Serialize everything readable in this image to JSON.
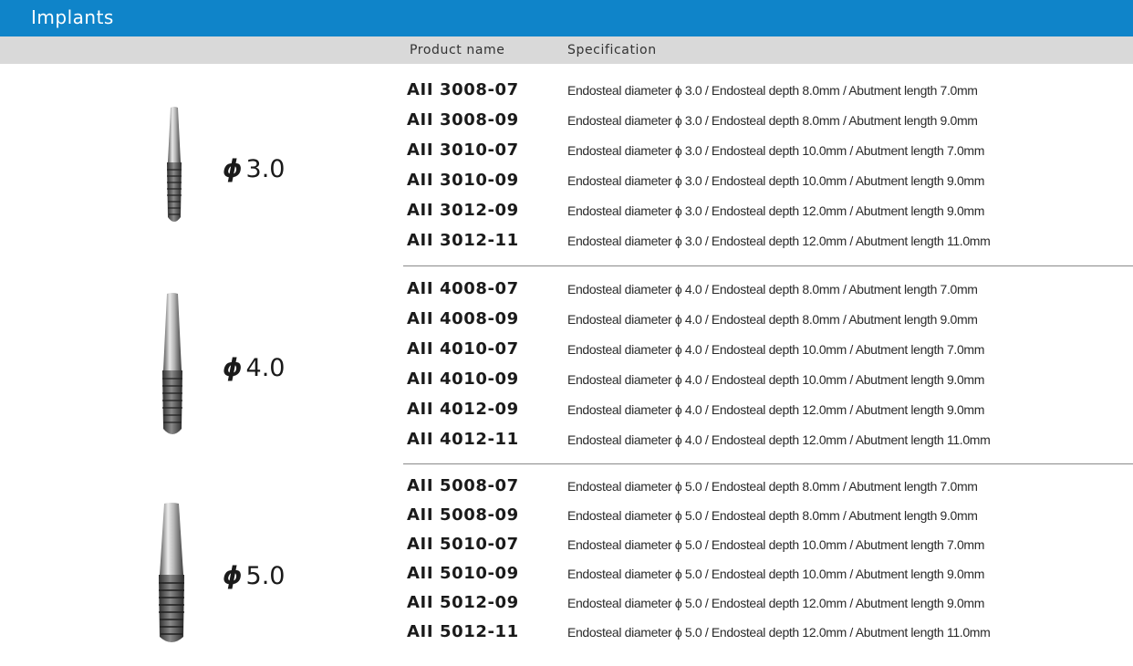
{
  "title": "Implants",
  "headers": {
    "product_name": "Product name",
    "specification": "Specification"
  },
  "colors": {
    "title_bar": "#0f84c9",
    "header_bar": "#d9d9d9"
  },
  "groups": [
    {
      "diameter": "3.0",
      "rows": [
        {
          "name": "AII 3008-07",
          "spec": "Endosteal diameter ϕ 3.0 / Endosteal depth 8.0mm / Abutment length 7.0mm"
        },
        {
          "name": "AII 3008-09",
          "spec": "Endosteal diameter ϕ 3.0 / Endosteal depth 8.0mm / Abutment length 9.0mm"
        },
        {
          "name": "AII 3010-07",
          "spec": "Endosteal diameter ϕ 3.0 / Endosteal depth 10.0mm / Abutment length 7.0mm"
        },
        {
          "name": "AII 3010-09",
          "spec": "Endosteal diameter ϕ 3.0 / Endosteal depth 10.0mm / Abutment length 9.0mm"
        },
        {
          "name": "AII 3012-09",
          "spec": "Endosteal diameter ϕ 3.0 / Endosteal depth 12.0mm / Abutment length 9.0mm"
        },
        {
          "name": "AII 3012-11",
          "spec": "Endosteal diameter ϕ 3.0 / Endosteal depth 12.0mm / Abutment length 11.0mm"
        }
      ]
    },
    {
      "diameter": "4.0",
      "rows": [
        {
          "name": "AII 4008-07",
          "spec": "Endosteal diameter ϕ 4.0 / Endosteal depth 8.0mm / Abutment length 7.0mm"
        },
        {
          "name": "AII 4008-09",
          "spec": "Endosteal diameter ϕ 4.0 / Endosteal depth 8.0mm / Abutment length 9.0mm"
        },
        {
          "name": "AII 4010-07",
          "spec": "Endosteal diameter ϕ 4.0 / Endosteal depth 10.0mm / Abutment length 7.0mm"
        },
        {
          "name": "AII 4010-09",
          "spec": "Endosteal diameter ϕ 4.0 / Endosteal depth 10.0mm / Abutment length 9.0mm"
        },
        {
          "name": "AII 4012-09",
          "spec": "Endosteal diameter ϕ 4.0 / Endosteal depth 12.0mm / Abutment length 9.0mm"
        },
        {
          "name": "AII 4012-11",
          "spec": "Endosteal diameter ϕ 4.0 / Endosteal depth 12.0mm / Abutment length 11.0mm"
        }
      ]
    },
    {
      "diameter": "5.0",
      "rows": [
        {
          "name": "AII 5008-07",
          "spec": "Endosteal diameter ϕ 5.0 / Endosteal depth 8.0mm / Abutment length 7.0mm"
        },
        {
          "name": "AII 5008-09",
          "spec": "Endosteal diameter ϕ 5.0 / Endosteal depth 8.0mm / Abutment length 9.0mm"
        },
        {
          "name": "AII 5010-07",
          "spec": "Endosteal diameter ϕ 5.0 / Endosteal depth 10.0mm / Abutment length 7.0mm"
        },
        {
          "name": "AII 5010-09",
          "spec": "Endosteal diameter ϕ 5.0 / Endosteal depth 10.0mm / Abutment length 9.0mm"
        },
        {
          "name": "AII 5012-09",
          "spec": "Endosteal diameter ϕ 5.0 / Endosteal depth 12.0mm / Abutment length 9.0mm"
        },
        {
          "name": "AII 5012-11",
          "spec": "Endosteal diameter ϕ 5.0 / Endosteal depth 12.0mm / Abutment length 11.0mm"
        }
      ]
    }
  ]
}
